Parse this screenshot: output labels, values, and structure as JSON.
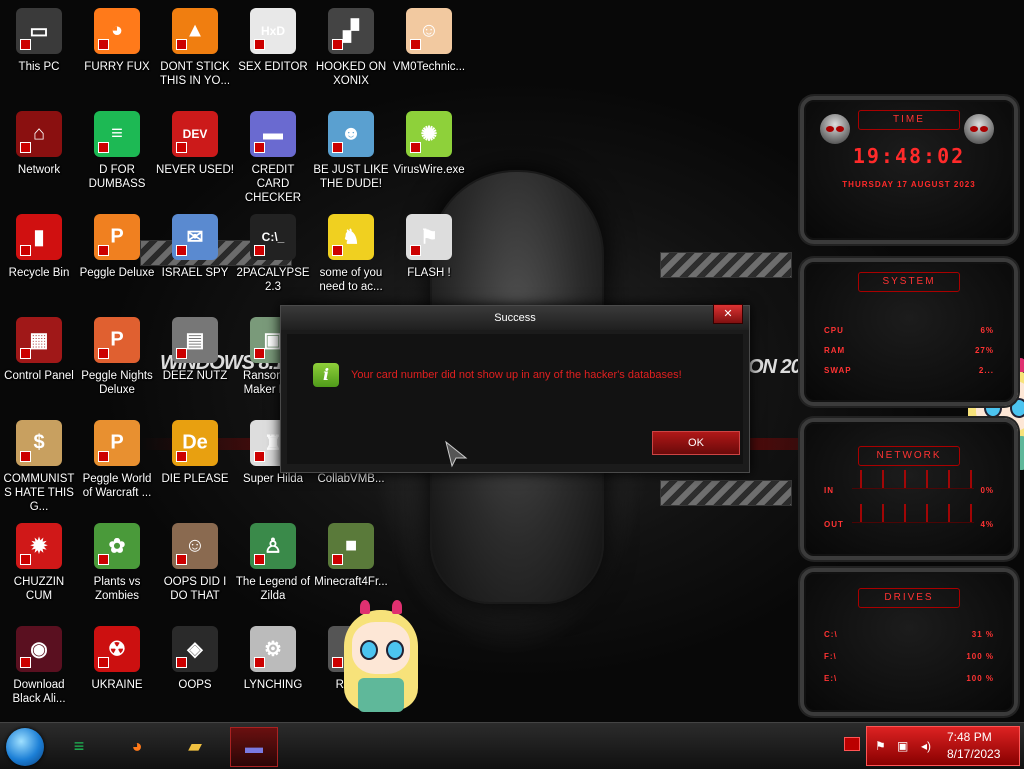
{
  "desktop": {
    "icons": [
      {
        "label": "This PC",
        "glyph": "▭",
        "bg": "#3a3a3a",
        "col": 0,
        "row": 0
      },
      {
        "label": "FURRY FUX",
        "glyph": "◕",
        "bg": "#ff7a1a",
        "col": 1,
        "row": 0
      },
      {
        "label": "DONT STICK THIS IN YO...",
        "glyph": "▲",
        "bg": "#f07e10",
        "col": 2,
        "row": 0
      },
      {
        "label": "SEX EDITOR",
        "glyph": "HxD",
        "bg": "#e8e8e8",
        "col": 3,
        "row": 0
      },
      {
        "label": "HOOKED ON XONIX",
        "glyph": "▞",
        "bg": "#444444",
        "col": 4,
        "row": 0
      },
      {
        "label": "VM0Technic...",
        "glyph": "☺",
        "bg": "#f2c9a0",
        "col": 5,
        "row": 0
      },
      {
        "label": "Network",
        "glyph": "⌂",
        "bg": "#8a1010",
        "col": 0,
        "row": 1
      },
      {
        "label": "D FOR DUMBASS",
        "glyph": "≡",
        "bg": "#1db954",
        "col": 1,
        "row": 1
      },
      {
        "label": "NEVER USED!",
        "glyph": "DEV",
        "bg": "#cc1a1a",
        "col": 2,
        "row": 1
      },
      {
        "label": "CREDIT CARD CHECKER",
        "glyph": "▬",
        "bg": "#6a6ad0",
        "col": 3,
        "row": 1
      },
      {
        "label": "BE JUST LIKE THE DUDE!",
        "glyph": "☻",
        "bg": "#5aa0d0",
        "col": 4,
        "row": 1
      },
      {
        "label": "VirusWire.exe",
        "glyph": "✺",
        "bg": "#8ed13a",
        "col": 5,
        "row": 1
      },
      {
        "label": "Recycle Bin",
        "glyph": "▮",
        "bg": "#d01010",
        "col": 0,
        "row": 2
      },
      {
        "label": "Peggle Deluxe",
        "glyph": "P",
        "bg": "#f08020",
        "col": 1,
        "row": 2
      },
      {
        "label": "ISRAEL SPY",
        "glyph": "✉",
        "bg": "#5a8ad0",
        "col": 2,
        "row": 2
      },
      {
        "label": "2PACALYPSE 2.3",
        "glyph": "C:\\_",
        "bg": "#222222",
        "col": 3,
        "row": 2
      },
      {
        "label": "some of you need to ac...",
        "glyph": "♞",
        "bg": "#f0d020",
        "col": 4,
        "row": 2
      },
      {
        "label": "FLASH !",
        "glyph": "⚑",
        "bg": "#dddddd",
        "col": 5,
        "row": 2
      },
      {
        "label": "Control Panel",
        "glyph": "▦",
        "bg": "#a01818",
        "col": 0,
        "row": 3
      },
      {
        "label": "Peggle Nights Deluxe",
        "glyph": "P",
        "bg": "#e06030",
        "col": 1,
        "row": 3
      },
      {
        "label": "DEEZ NUTZ",
        "glyph": "▤",
        "bg": "#777777",
        "col": 2,
        "row": 3
      },
      {
        "label": "Ransomw... Maker Bu...",
        "glyph": "▣",
        "bg": "#7a9a7a",
        "col": 3,
        "row": 3
      },
      {
        "label": "COMMUNISTS HATE THIS G...",
        "glyph": "$",
        "bg": "#c8a060",
        "col": 0,
        "row": 4
      },
      {
        "label": "Peggle World of Warcraft ...",
        "glyph": "P",
        "bg": "#e89030",
        "col": 1,
        "row": 4
      },
      {
        "label": "DIE PLEASE",
        "glyph": "De",
        "bg": "#e8a010",
        "col": 2,
        "row": 4
      },
      {
        "label": "Super Hilda",
        "glyph": "♜",
        "bg": "#dddddd",
        "col": 3,
        "row": 4
      },
      {
        "label": "CollabVMB...",
        "glyph": "▩",
        "bg": "#3a3a3a",
        "col": 4,
        "row": 4
      },
      {
        "label": "CHUZZIN CUM",
        "glyph": "✹",
        "bg": "#d01818",
        "col": 0,
        "row": 5
      },
      {
        "label": "Plants vs Zombies",
        "glyph": "✿",
        "bg": "#4a9a3a",
        "col": 1,
        "row": 5
      },
      {
        "label": "OOPS DID I DO THAT",
        "glyph": "☺",
        "bg": "#8a6a50",
        "col": 2,
        "row": 5
      },
      {
        "label": "The Legend of Zilda",
        "glyph": "♙",
        "bg": "#3a8a4a",
        "col": 3,
        "row": 5
      },
      {
        "label": "Minecraft4Fr...",
        "glyph": "■",
        "bg": "#5a7a3a",
        "col": 4,
        "row": 5
      },
      {
        "label": "Download Black Ali...",
        "glyph": "◉",
        "bg": "#5a1020",
        "col": 0,
        "row": 6
      },
      {
        "label": "UKRAINE",
        "glyph": "☢",
        "bg": "#cc1010",
        "col": 1,
        "row": 6
      },
      {
        "label": "OOPS",
        "glyph": "◈",
        "bg": "#2a2a2a",
        "col": 2,
        "row": 6
      },
      {
        "label": "LYNCHING",
        "glyph": "⚙",
        "bg": "#bbbbbb",
        "col": 3,
        "row": 6
      },
      {
        "label": "Ran...",
        "glyph": "◐",
        "bg": "#555555",
        "col": 4,
        "row": 6
      }
    ]
  },
  "wallpaper": {
    "text_left": "WiNDOWS 8.1",
    "text_right": "ON 20"
  },
  "dialog": {
    "title": "Success",
    "message": "Your card number did not show up in any of the hacker's databases!",
    "ok_label": "OK",
    "close_glyph": "✕",
    "info_glyph": "i"
  },
  "widgets": {
    "clock": {
      "header": "TIME",
      "time": "19:48:02",
      "date": "THURSDAY 17 AUGUST 2023"
    },
    "system": {
      "header": "SYSTEM",
      "rows": [
        {
          "label": "CPU",
          "value": "6%"
        },
        {
          "label": "RAM",
          "value": "27%"
        },
        {
          "label": "SWAP",
          "value": "2..."
        }
      ]
    },
    "network": {
      "header": "NETWORK",
      "rows": [
        {
          "label": "IN",
          "value": "0%"
        },
        {
          "label": "OUT",
          "value": "4%"
        }
      ]
    },
    "drives": {
      "header": "DRIVES",
      "rows": [
        {
          "label": "C:\\",
          "value": "31 %"
        },
        {
          "label": "F:\\",
          "value": "100 %"
        },
        {
          "label": "E:\\",
          "value": "100 %"
        }
      ]
    }
  },
  "taskbar": {
    "buttons": [
      {
        "name": "spotify",
        "glyph": "≡",
        "color": "#1db954"
      },
      {
        "name": "firefox",
        "glyph": "◕",
        "color": "#ff7a1a"
      },
      {
        "name": "file-explorer",
        "glyph": "▰",
        "color": "#f0c040"
      },
      {
        "name": "credit-card-checker",
        "glyph": "▬",
        "color": "#7a7ae0"
      }
    ],
    "time": "7:48 PM",
    "date": "8/17/2023"
  },
  "colors": {
    "accent": "#cc1111",
    "message": "#e02020"
  }
}
